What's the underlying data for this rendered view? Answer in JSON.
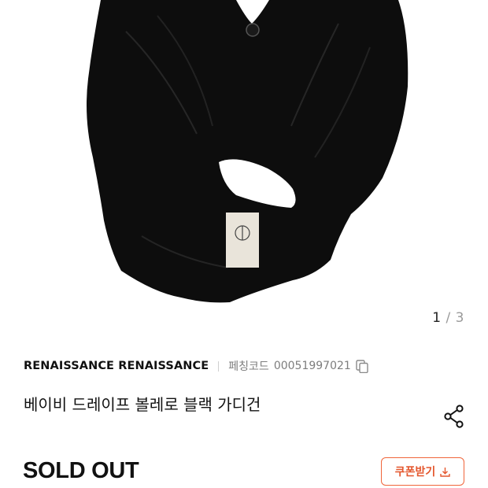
{
  "gallery": {
    "current": "1",
    "separator": "/",
    "total": "3"
  },
  "product": {
    "brand": "RENAISSANCE RENAISSANCE",
    "code_label": "페칭코드",
    "code_value": "00051997021",
    "title": "베이비 드레이프 볼레로 블랙 가디건",
    "status": "SOLD OUT"
  },
  "actions": {
    "coupon_label": "쿠폰받기"
  },
  "icons": {
    "copy": "copy-icon",
    "share": "share-icon",
    "download": "download-icon"
  },
  "colors": {
    "accent": "#e4572e",
    "text": "#111111",
    "muted": "#7d7d7d"
  }
}
